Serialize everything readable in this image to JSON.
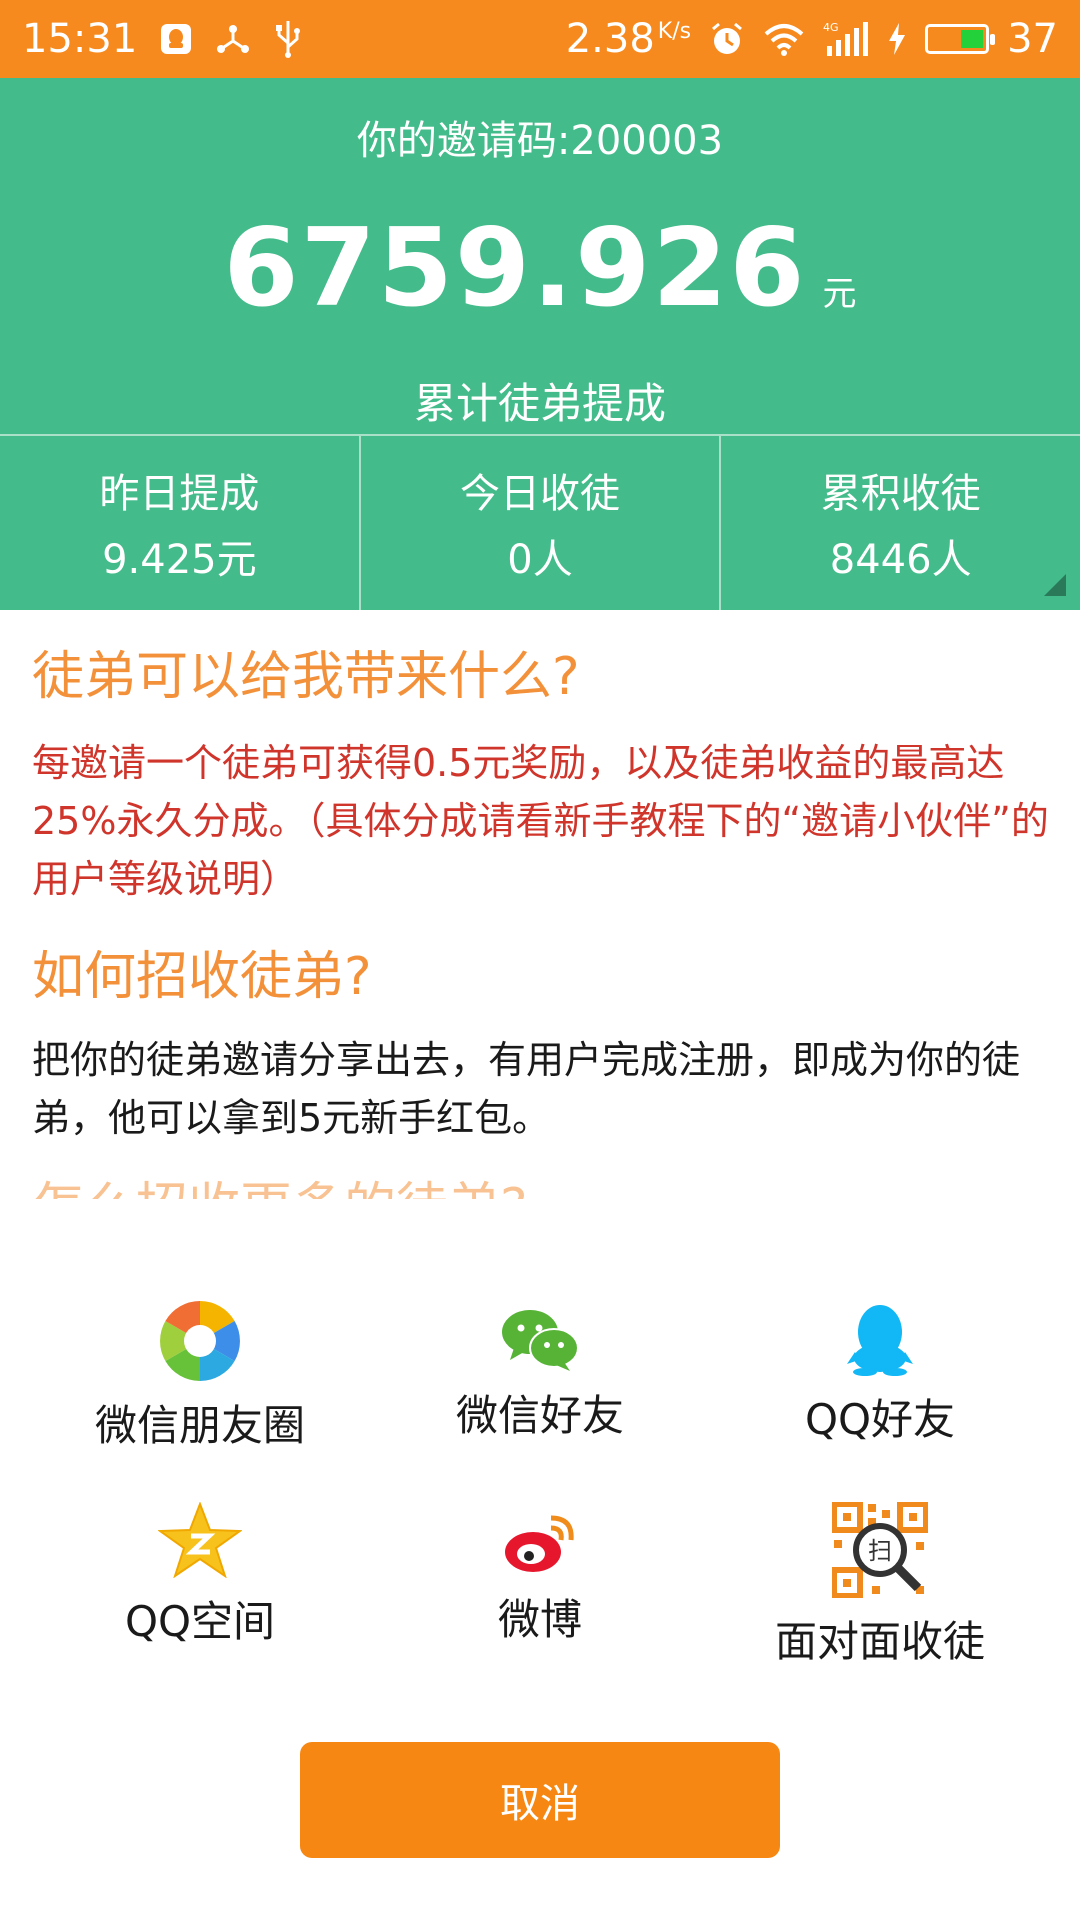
{
  "status_bar": {
    "time": "15:31",
    "speed": "2.38",
    "speed_unit": "K/s",
    "battery": "37",
    "icons": [
      "qq-notification-icon",
      "share-icon",
      "usb-icon",
      "alarm-icon",
      "wifi-icon",
      "signal-4g-icon",
      "charging-icon",
      "battery-icon"
    ]
  },
  "header": {
    "invite_code": "你的邀请码:200003",
    "total_amount": "6759.926",
    "amount_unit": "元",
    "amount_label": "累计徒弟提成"
  },
  "stats": [
    {
      "title": "昨日提成",
      "value": "9.425元"
    },
    {
      "title": "今日收徒",
      "value": "0人"
    },
    {
      "title": "累积收徒",
      "value": "8446人"
    }
  ],
  "content": {
    "q1": "徒弟可以给我带来什么?",
    "a1": "每邀请一个徒弟可获得0.5元奖励，以及徒弟收益的最高达25%永久分成。（具体分成请看新手教程下的“邀请小伙伴”的用户等级说明）",
    "q2": "如何招收徒弟?",
    "a2": "把你的徒弟邀请分享出去，有用户完成注册，即成为你的徒弟，他可以拿到5元新手红包。",
    "q3_partial": "怎么招收更多的徒弟?"
  },
  "share": {
    "items": [
      {
        "label": "微信朋友圈",
        "icon": "wechat-moments-icon"
      },
      {
        "label": "微信好友",
        "icon": "wechat-icon"
      },
      {
        "label": "QQ好友",
        "icon": "qq-icon"
      },
      {
        "label": "QQ空间",
        "icon": "qzone-icon"
      },
      {
        "label": "微博",
        "icon": "weibo-icon"
      },
      {
        "label": "面对面收徒",
        "icon": "qr-scan-icon"
      }
    ],
    "qr_scan_char": "扫",
    "cancel": "取消"
  },
  "colors": {
    "status_bar": "#f68a1e",
    "header_green": "#44bb8b",
    "orange_heading": "#f3913a",
    "red_text": "#d0352c",
    "cancel_button": "#f68712"
  }
}
